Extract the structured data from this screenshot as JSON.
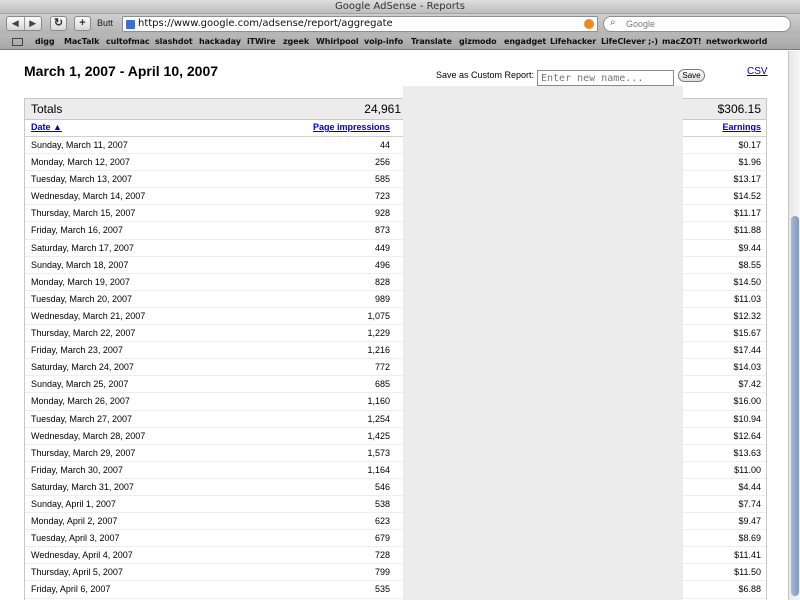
{
  "window": {
    "title": "Google AdSense - Reports"
  },
  "toolbar": {
    "back_icon": "◀",
    "forward_icon": "▶",
    "reload_icon": "↻",
    "add_icon": "+",
    "butt_label": "Butt",
    "url": "https://www.google.com/adsense/report/aggregate",
    "search_placeholder": "Google"
  },
  "bookmarks": [
    "digg",
    "MacTalk",
    "cultofmac",
    "slashdot",
    "hackaday",
    "iTWire",
    "zgeek",
    "Whirlpool",
    "voip-info",
    "Translate",
    "gizmodo",
    "engadget",
    "Lifehacker",
    "LifeClever ;-)",
    "macZOT!",
    "networkworld"
  ],
  "report": {
    "date_range": "March 1, 2007 - April 10, 2007",
    "save_label": "Save as Custom Report:",
    "save_placeholder": "Enter new name...",
    "save_button": "Save",
    "csv_link": "CSV",
    "totals": {
      "label": "Totals",
      "impressions": "24,961",
      "earnings": "$306.15"
    },
    "headers": {
      "date": "Date ▲",
      "impressions": "Page impressions",
      "earnings": "Earnings"
    },
    "rows": [
      {
        "date": "Sunday, March 11, 2007",
        "impressions": "44",
        "earnings": "$0.17"
      },
      {
        "date": "Monday, March 12, 2007",
        "impressions": "256",
        "earnings": "$1.96"
      },
      {
        "date": "Tuesday, March 13, 2007",
        "impressions": "585",
        "earnings": "$13.17"
      },
      {
        "date": "Wednesday, March 14, 2007",
        "impressions": "723",
        "earnings": "$14.52"
      },
      {
        "date": "Thursday, March 15, 2007",
        "impressions": "928",
        "earnings": "$11.17"
      },
      {
        "date": "Friday, March 16, 2007",
        "impressions": "873",
        "earnings": "$11.88"
      },
      {
        "date": "Saturday, March 17, 2007",
        "impressions": "449",
        "earnings": "$9.44"
      },
      {
        "date": "Sunday, March 18, 2007",
        "impressions": "496",
        "earnings": "$8.55"
      },
      {
        "date": "Monday, March 19, 2007",
        "impressions": "828",
        "earnings": "$14.50"
      },
      {
        "date": "Tuesday, March 20, 2007",
        "impressions": "989",
        "earnings": "$11.03"
      },
      {
        "date": "Wednesday, March 21, 2007",
        "impressions": "1,075",
        "earnings": "$12.32"
      },
      {
        "date": "Thursday, March 22, 2007",
        "impressions": "1,229",
        "earnings": "$15.67"
      },
      {
        "date": "Friday, March 23, 2007",
        "impressions": "1,216",
        "earnings": "$17.44"
      },
      {
        "date": "Saturday, March 24, 2007",
        "impressions": "772",
        "earnings": "$14.03"
      },
      {
        "date": "Sunday, March 25, 2007",
        "impressions": "685",
        "earnings": "$7.42"
      },
      {
        "date": "Monday, March 26, 2007",
        "impressions": "1,160",
        "earnings": "$16.00"
      },
      {
        "date": "Tuesday, March 27, 2007",
        "impressions": "1,254",
        "earnings": "$10.94"
      },
      {
        "date": "Wednesday, March 28, 2007",
        "impressions": "1,425",
        "earnings": "$12.64"
      },
      {
        "date": "Thursday, March 29, 2007",
        "impressions": "1,573",
        "earnings": "$13.63"
      },
      {
        "date": "Friday, March 30, 2007",
        "impressions": "1,164",
        "earnings": "$11.00"
      },
      {
        "date": "Saturday, March 31, 2007",
        "impressions": "546",
        "earnings": "$4.44"
      },
      {
        "date": "Sunday, April 1, 2007",
        "impressions": "538",
        "earnings": "$7.74"
      },
      {
        "date": "Monday, April 2, 2007",
        "impressions": "623",
        "earnings": "$9.47"
      },
      {
        "date": "Tuesday, April 3, 2007",
        "impressions": "679",
        "earnings": "$8.69"
      },
      {
        "date": "Wednesday, April 4, 2007",
        "impressions": "728",
        "earnings": "$11.41"
      },
      {
        "date": "Thursday, April 5, 2007",
        "impressions": "799",
        "earnings": "$11.50"
      },
      {
        "date": "Friday, April 6, 2007",
        "impressions": "535",
        "earnings": "$6.88"
      }
    ]
  }
}
